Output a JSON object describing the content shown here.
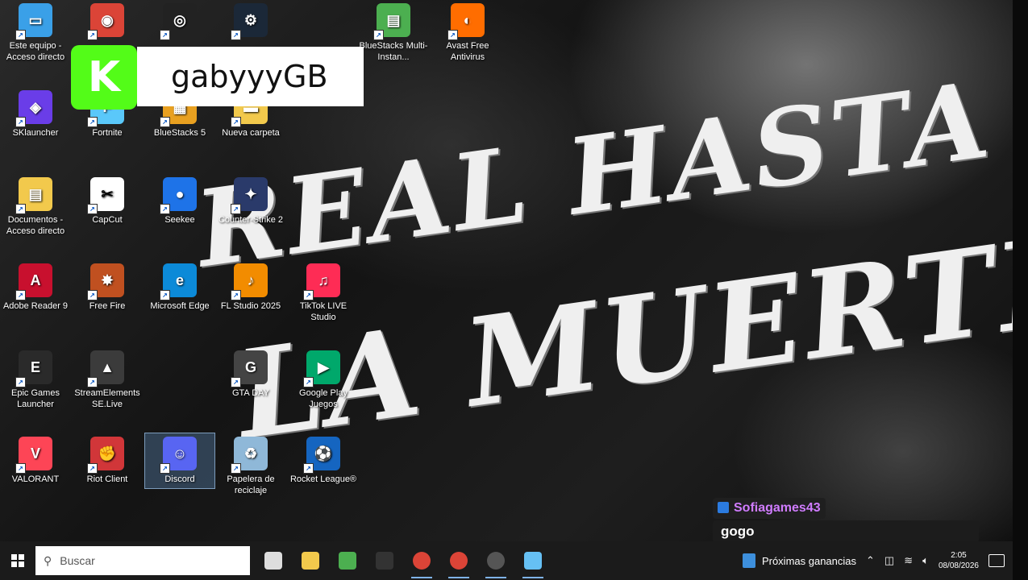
{
  "wallpaper": {
    "line1": "REAL HASTA",
    "line2": "LA MUERTE"
  },
  "streamer": {
    "platform_icon": "kick-logo-icon",
    "name": "gabyyyGB"
  },
  "desktop_icons": [
    {
      "label": "Este equipo - Acceso directo",
      "icon": "computer-icon",
      "color": "#3aa0e8",
      "glyph": "▭"
    },
    {
      "label": "",
      "icon": "chrome-icon",
      "color": "#db4437",
      "glyph": "◉"
    },
    {
      "label": "",
      "icon": "obs-icon",
      "color": "#222222",
      "glyph": "◎"
    },
    {
      "label": "",
      "icon": "steam-icon",
      "color": "#1b2838",
      "glyph": "⚙"
    },
    {
      "label": "BlueStacks Multi-Instan...",
      "icon": "bluestacks-multi-icon",
      "color": "#4caf50",
      "glyph": "▤"
    },
    {
      "label": "Avast Free Antivirus",
      "icon": "avast-icon",
      "color": "#ff6d00",
      "glyph": "◐"
    },
    {
      "label": "SKlauncher",
      "icon": "sklauncher-icon",
      "color": "#6a3de8",
      "glyph": "◈"
    },
    {
      "label": "Fortnite",
      "icon": "fortnite-icon",
      "color": "#5ac8fa",
      "glyph": "F"
    },
    {
      "label": "BlueStacks 5",
      "icon": "bluestacks-icon",
      "color": "#e8a020",
      "glyph": "▦"
    },
    {
      "label": "Nueva carpeta",
      "icon": "folder-icon",
      "color": "#f2c94c",
      "glyph": "▬"
    },
    {
      "label": "Documentos - Acceso directo",
      "icon": "documents-icon",
      "color": "#f2c94c",
      "glyph": "▤"
    },
    {
      "label": "CapCut",
      "icon": "capcut-icon",
      "color": "#ffffff",
      "glyph": "✂"
    },
    {
      "label": "Seekee",
      "icon": "seekee-icon",
      "color": "#1e73e8",
      "glyph": "●"
    },
    {
      "label": "Counter-Strike 2",
      "icon": "counter-strike-icon",
      "color": "#2a3a6a",
      "glyph": "✦"
    },
    {
      "label": "Adobe Reader 9",
      "icon": "adobe-reader-icon",
      "color": "#c8102e",
      "glyph": "A"
    },
    {
      "label": "Free Fire",
      "icon": "free-fire-icon",
      "color": "#c05020",
      "glyph": "✸"
    },
    {
      "label": "Microsoft Edge",
      "icon": "edge-icon",
      "color": "#0c8ad8",
      "glyph": "e"
    },
    {
      "label": "FL Studio 2025",
      "icon": "fl-studio-icon",
      "color": "#f28c00",
      "glyph": "♪"
    },
    {
      "label": "TikTok LIVE Studio",
      "icon": "tiktok-icon",
      "color": "#fe2c55",
      "glyph": "♫"
    },
    {
      "label": "Epic Games Launcher",
      "icon": "epic-games-icon",
      "color": "#2a2a2a",
      "glyph": "E"
    },
    {
      "label": "StreamElements SE.Live",
      "icon": "streamelements-icon",
      "color": "#3b3b3b",
      "glyph": "▲"
    },
    {
      "label": "GTA DAY",
      "icon": "gta-icon",
      "color": "#444444",
      "glyph": "G"
    },
    {
      "label": "Google Play Juegos",
      "icon": "google-play-games-icon",
      "color": "#00a86b",
      "glyph": "▶"
    },
    {
      "label": "VALORANT",
      "icon": "valorant-icon",
      "color": "#fd4556",
      "glyph": "V"
    },
    {
      "label": "Riot Client",
      "icon": "riot-client-icon",
      "color": "#d13639",
      "glyph": "✊"
    },
    {
      "label": "Discord",
      "icon": "discord-icon",
      "color": "#5865f2",
      "glyph": "☺"
    },
    {
      "label": "Papelera de reciclaje",
      "icon": "recycle-bin-icon",
      "color": "#8fb8d8",
      "glyph": "♻"
    },
    {
      "label": "Rocket League®",
      "icon": "rocket-league-icon",
      "color": "#1565c0",
      "glyph": "⚽"
    }
  ],
  "chat": {
    "username": "Sofiagames43",
    "message": "gogo",
    "username_color": "#d07cff"
  },
  "taskbar": {
    "search_placeholder": "Buscar",
    "apps": [
      {
        "icon": "task-view-icon",
        "color": "#dddddd"
      },
      {
        "icon": "file-explorer-icon",
        "color": "#f2c94c"
      },
      {
        "icon": "bluestacks-icon",
        "color": "#4caf50"
      },
      {
        "icon": "epic-games-icon",
        "color": "#333333"
      },
      {
        "icon": "chrome-icon",
        "color": "#db4437"
      },
      {
        "icon": "chrome-icon",
        "color": "#db4437"
      },
      {
        "icon": "obs-icon",
        "color": "#555555"
      },
      {
        "icon": "steam-icon",
        "color": "#66c0f4"
      }
    ],
    "earnings_label": "Próximas ganancias",
    "time": "2:05",
    "date": "08/08/2026"
  }
}
